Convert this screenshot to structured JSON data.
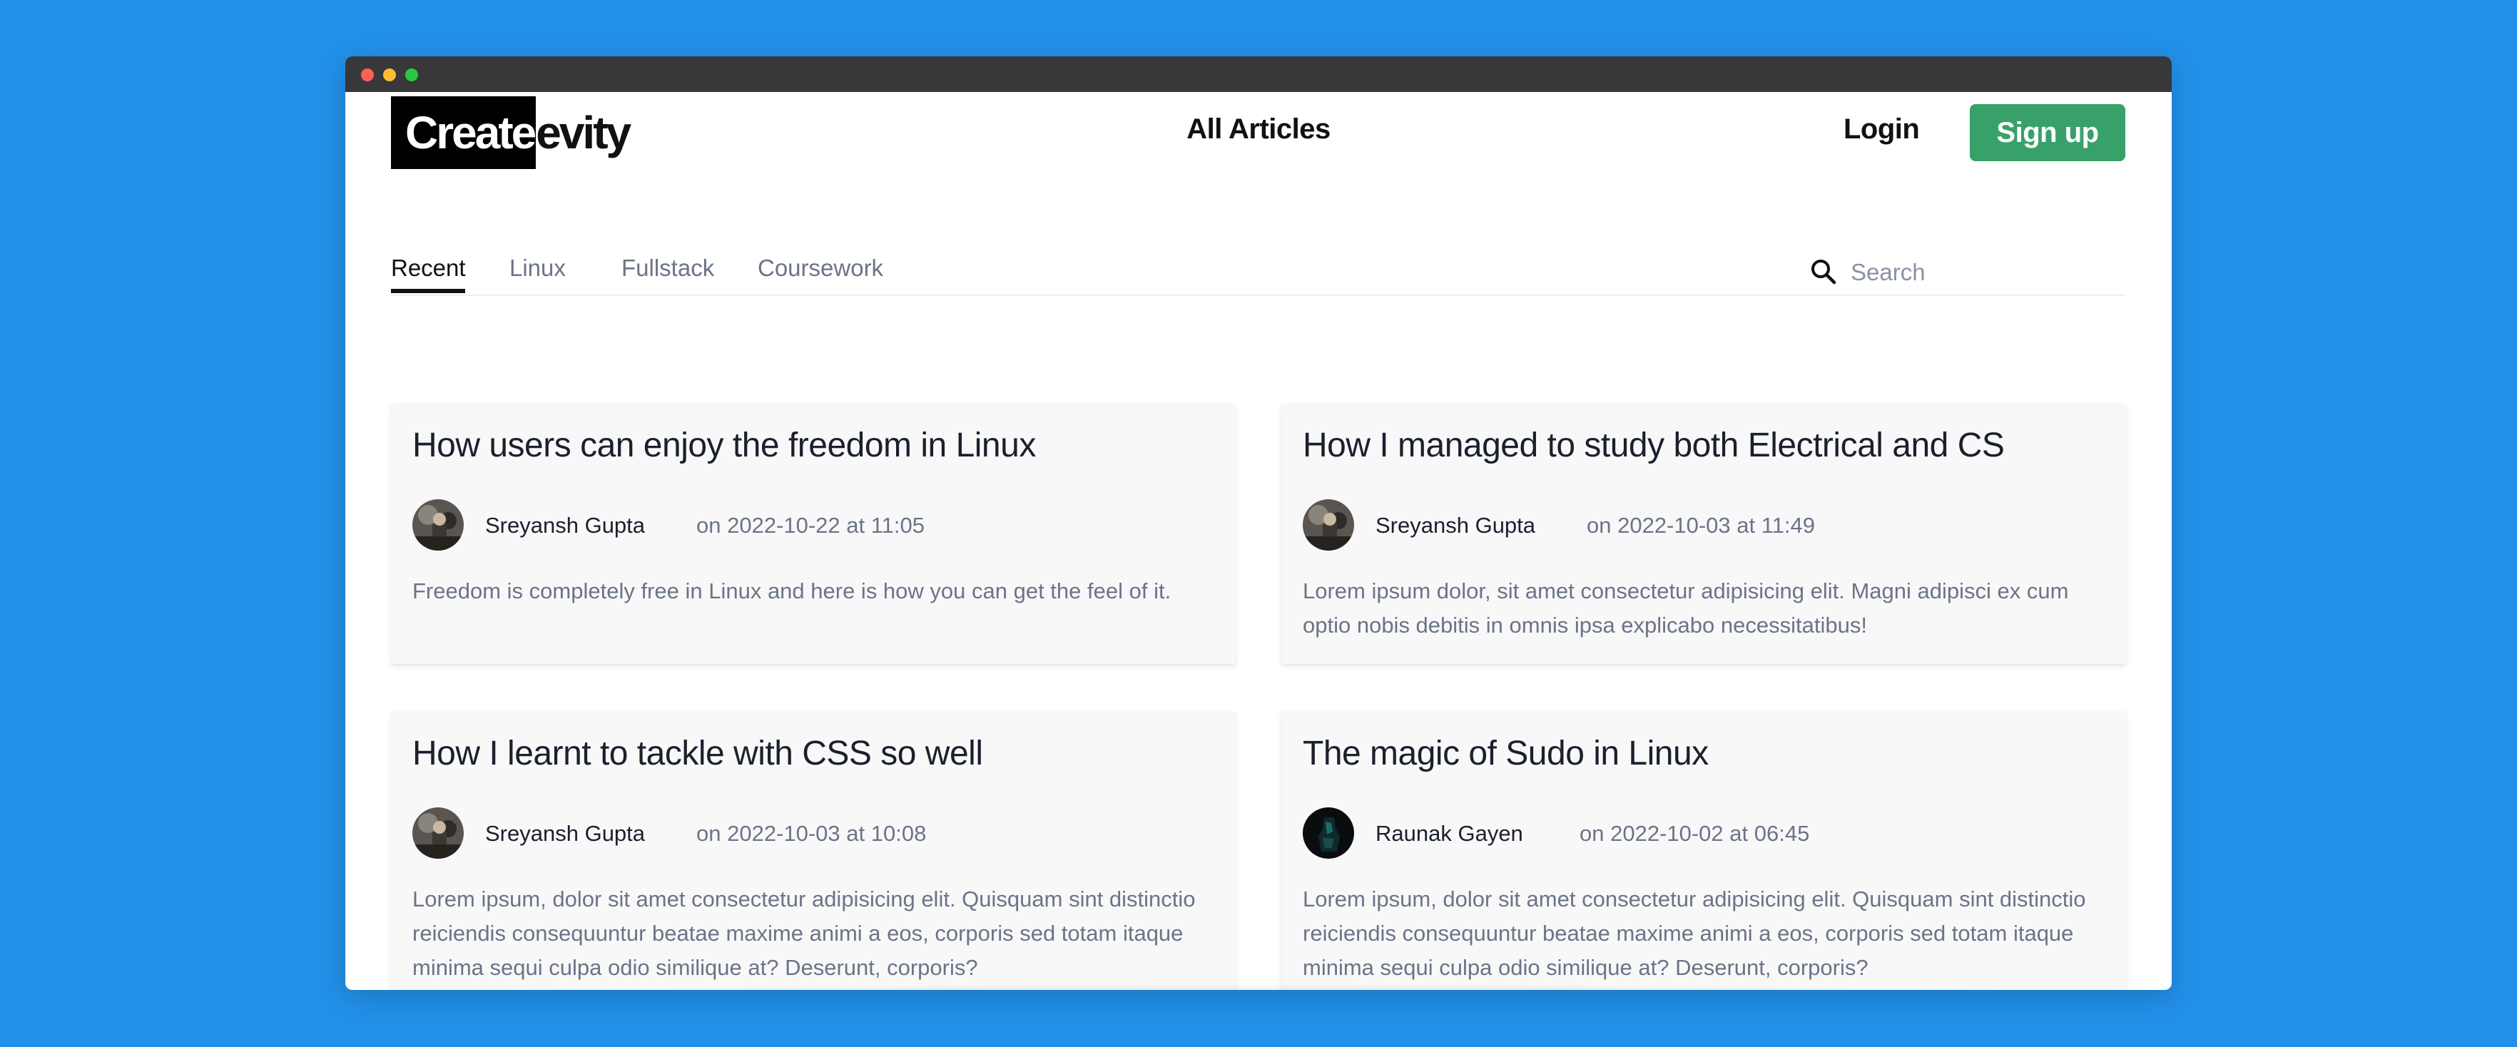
{
  "header": {
    "logo_boxed": "Create",
    "logo_rest": "evity",
    "center_title": "All Articles",
    "login_label": "Login",
    "signup_label": "Sign up"
  },
  "tabs": [
    {
      "label": "Recent",
      "active": true
    },
    {
      "label": "Linux",
      "active": false
    },
    {
      "label": "Fullstack",
      "active": false
    },
    {
      "label": "Coursework",
      "active": false
    }
  ],
  "search": {
    "placeholder": "Search",
    "value": ""
  },
  "articles": [
    {
      "title": "How users can enjoy the freedom in Linux",
      "author": "Sreyansh Gupta",
      "date": "on 2022-10-22 at 11:05",
      "excerpt": "Freedom is completely free in Linux and here is how you can get the feel of it."
    },
    {
      "title": "How I managed to study both Electrical and CS",
      "author": "Sreyansh Gupta",
      "date": "on 2022-10-03 at 11:49",
      "excerpt": "Lorem ipsum dolor, sit amet consectetur adipisicing elit. Magni adipisci ex cum optio nobis debitis in omnis ipsa explicabo necessitatibus!"
    },
    {
      "title": "How I learnt to tackle with CSS so well",
      "author": "Sreyansh Gupta",
      "date": "on 2022-10-03 at 10:08",
      "excerpt": "Lorem ipsum, dolor sit amet consectetur adipisicing elit. Quisquam sint distinctio reiciendis consequuntur beatae maxime animi a eos, corporis sed totam itaque minima sequi culpa odio similique at? Deserunt, corporis?"
    },
    {
      "title": "The magic of Sudo in Linux",
      "author": "Raunak Gayen",
      "date": "on 2022-10-02 at 06:45",
      "excerpt": "Lorem ipsum, dolor sit amet consectetur adipisicing elit. Quisquam sint distinctio reiciendis consequuntur beatae maxime animi a eos, corporis sed totam itaque minima sequi culpa odio similique at? Deserunt, corporis?"
    }
  ],
  "colors": {
    "background": "#2290e8",
    "signup_button": "#38a169",
    "titlebar": "#38383b"
  }
}
